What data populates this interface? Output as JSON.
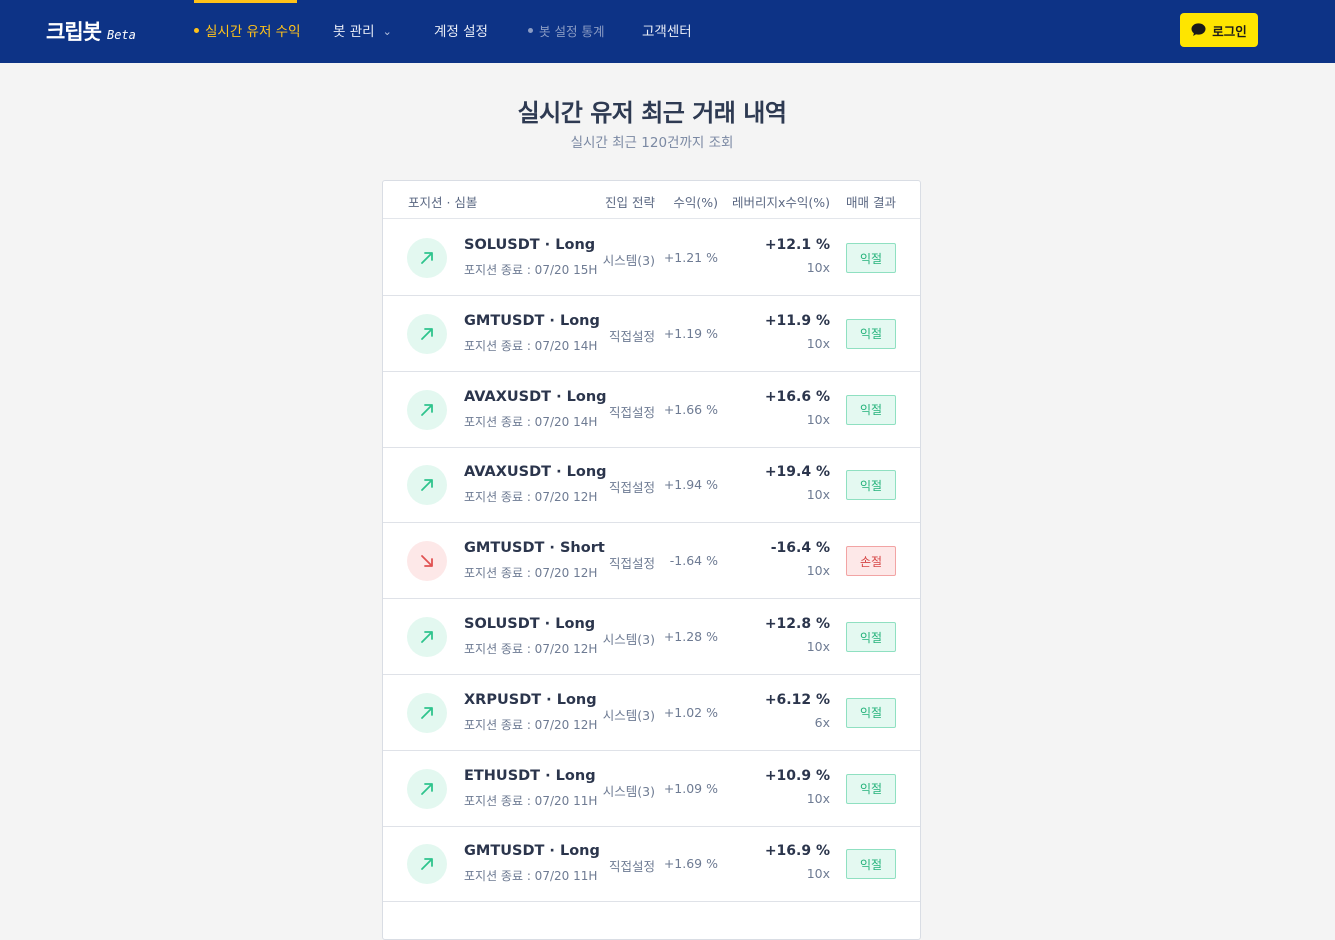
{
  "header": {
    "brand": "크립봇",
    "brand_tag": "Beta",
    "nav": [
      {
        "label": "실시간 유저 수익"
      },
      {
        "label": "봇 관리"
      },
      {
        "label": "계정 설정"
      },
      {
        "label": "봇 설정 통계"
      },
      {
        "label": "고객센터"
      }
    ],
    "login_label": "로그인"
  },
  "main": {
    "title": "실시간 유저 최근 거래 내역",
    "subtitle": "실시간 최근 120건까지 조회"
  },
  "table": {
    "columns": [
      "포지션 · 심볼",
      "진입 전략",
      "수익(%)",
      "레버리지x수익(%)",
      "매매 결과"
    ],
    "rows": [
      {
        "symbol": "SOLUSDT · Long",
        "closed": "포지션 종료 : 07/20 15H",
        "strategy": "시스템(3)",
        "pct": "+1.21 %",
        "lev_pct": "+12.1 %",
        "lev": "10x",
        "result": "익절",
        "direction": "up"
      },
      {
        "symbol": "GMTUSDT · Long",
        "closed": "포지션 종료 : 07/20 14H",
        "strategy": "직접설정",
        "pct": "+1.19 %",
        "lev_pct": "+11.9 %",
        "lev": "10x",
        "result": "익절",
        "direction": "up"
      },
      {
        "symbol": "AVAXUSDT · Long",
        "closed": "포지션 종료 : 07/20 14H",
        "strategy": "직접설정",
        "pct": "+1.66 %",
        "lev_pct": "+16.6 %",
        "lev": "10x",
        "result": "익절",
        "direction": "up"
      },
      {
        "symbol": "AVAXUSDT · Long",
        "closed": "포지션 종료 : 07/20 12H",
        "strategy": "직접설정",
        "pct": "+1.94 %",
        "lev_pct": "+19.4 %",
        "lev": "10x",
        "result": "익절",
        "direction": "up"
      },
      {
        "symbol": "GMTUSDT · Short",
        "closed": "포지션 종료 : 07/20 12H",
        "strategy": "직접설정",
        "pct": "-1.64 %",
        "lev_pct": "-16.4 %",
        "lev": "10x",
        "result": "손절",
        "direction": "down"
      },
      {
        "symbol": "SOLUSDT · Long",
        "closed": "포지션 종료 : 07/20 12H",
        "strategy": "시스템(3)",
        "pct": "+1.28 %",
        "lev_pct": "+12.8 %",
        "lev": "10x",
        "result": "익절",
        "direction": "up"
      },
      {
        "symbol": "XRPUSDT · Long",
        "closed": "포지션 종료 : 07/20 12H",
        "strategy": "시스템(3)",
        "pct": "+1.02 %",
        "lev_pct": "+6.12 %",
        "lev": "6x",
        "result": "익절",
        "direction": "up"
      },
      {
        "symbol": "ETHUSDT · Long",
        "closed": "포지션 종료 : 07/20 11H",
        "strategy": "시스템(3)",
        "pct": "+1.09 %",
        "lev_pct": "+10.9 %",
        "lev": "10x",
        "result": "익절",
        "direction": "up"
      },
      {
        "symbol": "GMTUSDT · Long",
        "closed": "포지션 종료 : 07/20 11H",
        "strategy": "직접설정",
        "pct": "+1.69 %",
        "lev_pct": "+16.9 %",
        "lev": "10x",
        "result": "익절",
        "direction": "up"
      }
    ]
  },
  "colors": {
    "header_bg": "#0d3386",
    "accent": "#ffc21a",
    "kakao": "#fee500",
    "profit": "#23b27a",
    "loss": "#d64545"
  },
  "icons": {
    "up": "arrow-up-right-icon",
    "down": "arrow-down-right-icon",
    "login": "kakao-chat-icon"
  }
}
